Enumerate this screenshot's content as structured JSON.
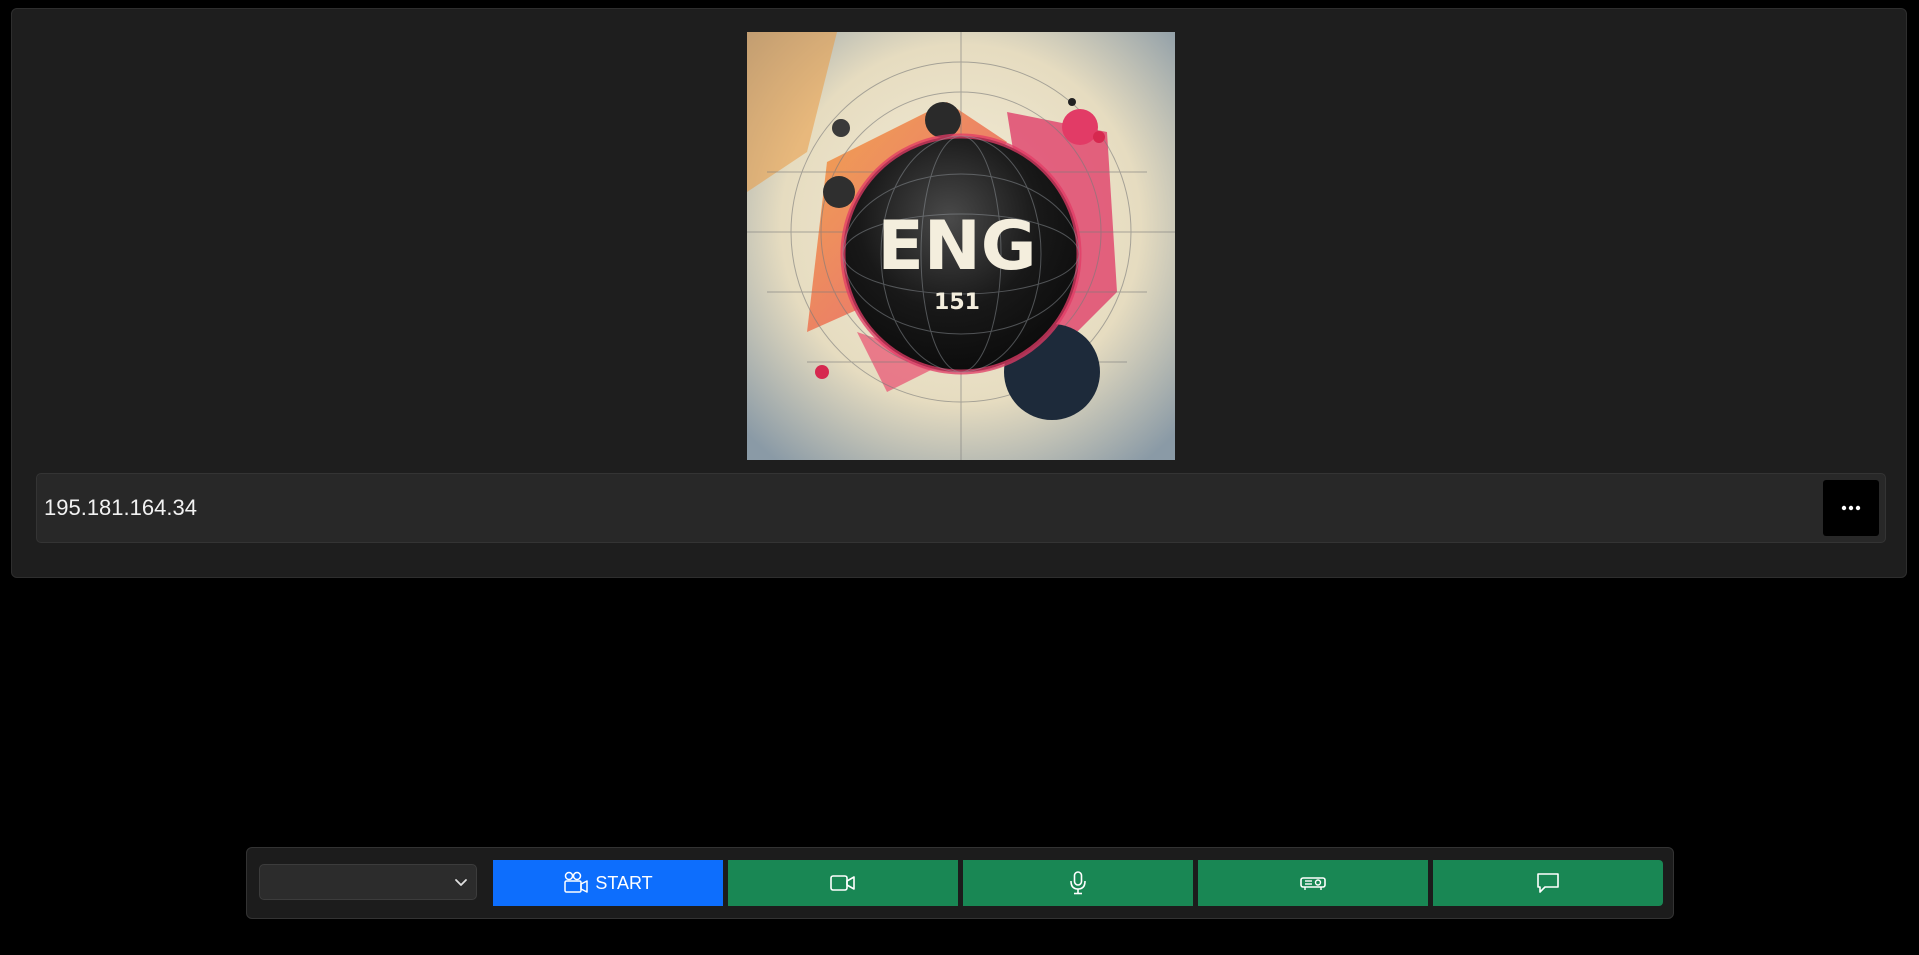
{
  "stream": {
    "thumbnail": {
      "title": "ENG",
      "subtitle": "151"
    },
    "address": "195.181.164.34",
    "more_icon": "ellipsis-icon"
  },
  "toolbar": {
    "source_select": {
      "selected_value": ""
    },
    "start_label": "START",
    "start_icon": "camera-reels-icon",
    "buttons": [
      {
        "icon": "video-camera-icon"
      },
      {
        "icon": "microphone-icon"
      },
      {
        "icon": "projector-icon"
      },
      {
        "icon": "chat-bubble-icon"
      }
    ]
  },
  "colors": {
    "page_bg": "#000000",
    "card_bg": "#1e1e1e",
    "start_blue": "#0d6efd",
    "action_green": "#198754"
  }
}
